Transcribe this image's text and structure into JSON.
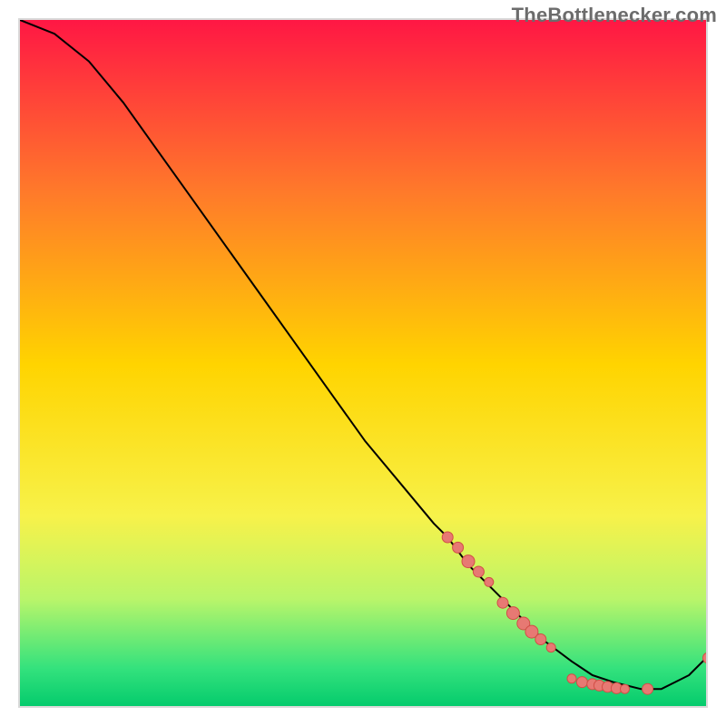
{
  "attribution": "TheBottlenecker.com",
  "chart_data": {
    "type": "line",
    "title": "",
    "xlabel": "",
    "ylabel": "",
    "xlim": [
      0,
      100
    ],
    "ylim": [
      0,
      100
    ],
    "grid": false,
    "gradient_top_color": "#ff1a45",
    "gradient_mid_color": "#ffd400",
    "gradient_bottom_color": "#00e676",
    "gradient_stops": [
      {
        "offset": 0,
        "color": "#ff1744"
      },
      {
        "offset": 25,
        "color": "#ff7a2a"
      },
      {
        "offset": 50,
        "color": "#ffd400"
      },
      {
        "offset": 72,
        "color": "#f7f24a"
      },
      {
        "offset": 84,
        "color": "#b9f56a"
      },
      {
        "offset": 94,
        "color": "#34e27d"
      },
      {
        "offset": 100,
        "color": "#00c96b"
      }
    ],
    "curve": {
      "x": [
        0,
        5,
        10,
        15,
        20,
        25,
        30,
        35,
        40,
        45,
        50,
        55,
        60,
        62,
        65,
        68,
        70,
        73,
        76,
        80,
        83,
        86,
        90,
        93,
        95,
        97,
        100
      ],
      "y": [
        100,
        98,
        94,
        88,
        81,
        74,
        67,
        60,
        53,
        46,
        39,
        33,
        27,
        25,
        21,
        18,
        16,
        13,
        10,
        7,
        5,
        4,
        3,
        3,
        4,
        5,
        8
      ]
    },
    "points": [
      {
        "x": 62,
        "y": 25,
        "r": 6
      },
      {
        "x": 63.5,
        "y": 23.5,
        "r": 6
      },
      {
        "x": 65,
        "y": 21.5,
        "r": 7
      },
      {
        "x": 66.5,
        "y": 20,
        "r": 6
      },
      {
        "x": 68,
        "y": 18.5,
        "r": 5
      },
      {
        "x": 70,
        "y": 15.5,
        "r": 6
      },
      {
        "x": 71.5,
        "y": 14,
        "r": 7
      },
      {
        "x": 73,
        "y": 12.5,
        "r": 7
      },
      {
        "x": 74.2,
        "y": 11.3,
        "r": 7
      },
      {
        "x": 75.5,
        "y": 10.2,
        "r": 6
      },
      {
        "x": 77,
        "y": 9,
        "r": 5
      },
      {
        "x": 80,
        "y": 4.5,
        "r": 5
      },
      {
        "x": 81.5,
        "y": 4,
        "r": 6
      },
      {
        "x": 83,
        "y": 3.7,
        "r": 6
      },
      {
        "x": 84,
        "y": 3.5,
        "r": 6
      },
      {
        "x": 85.2,
        "y": 3.3,
        "r": 6
      },
      {
        "x": 86.5,
        "y": 3.1,
        "r": 6
      },
      {
        "x": 87.7,
        "y": 3,
        "r": 5
      },
      {
        "x": 91,
        "y": 3,
        "r": 6
      },
      {
        "x": 99.8,
        "y": 7.5,
        "r": 6
      }
    ]
  }
}
